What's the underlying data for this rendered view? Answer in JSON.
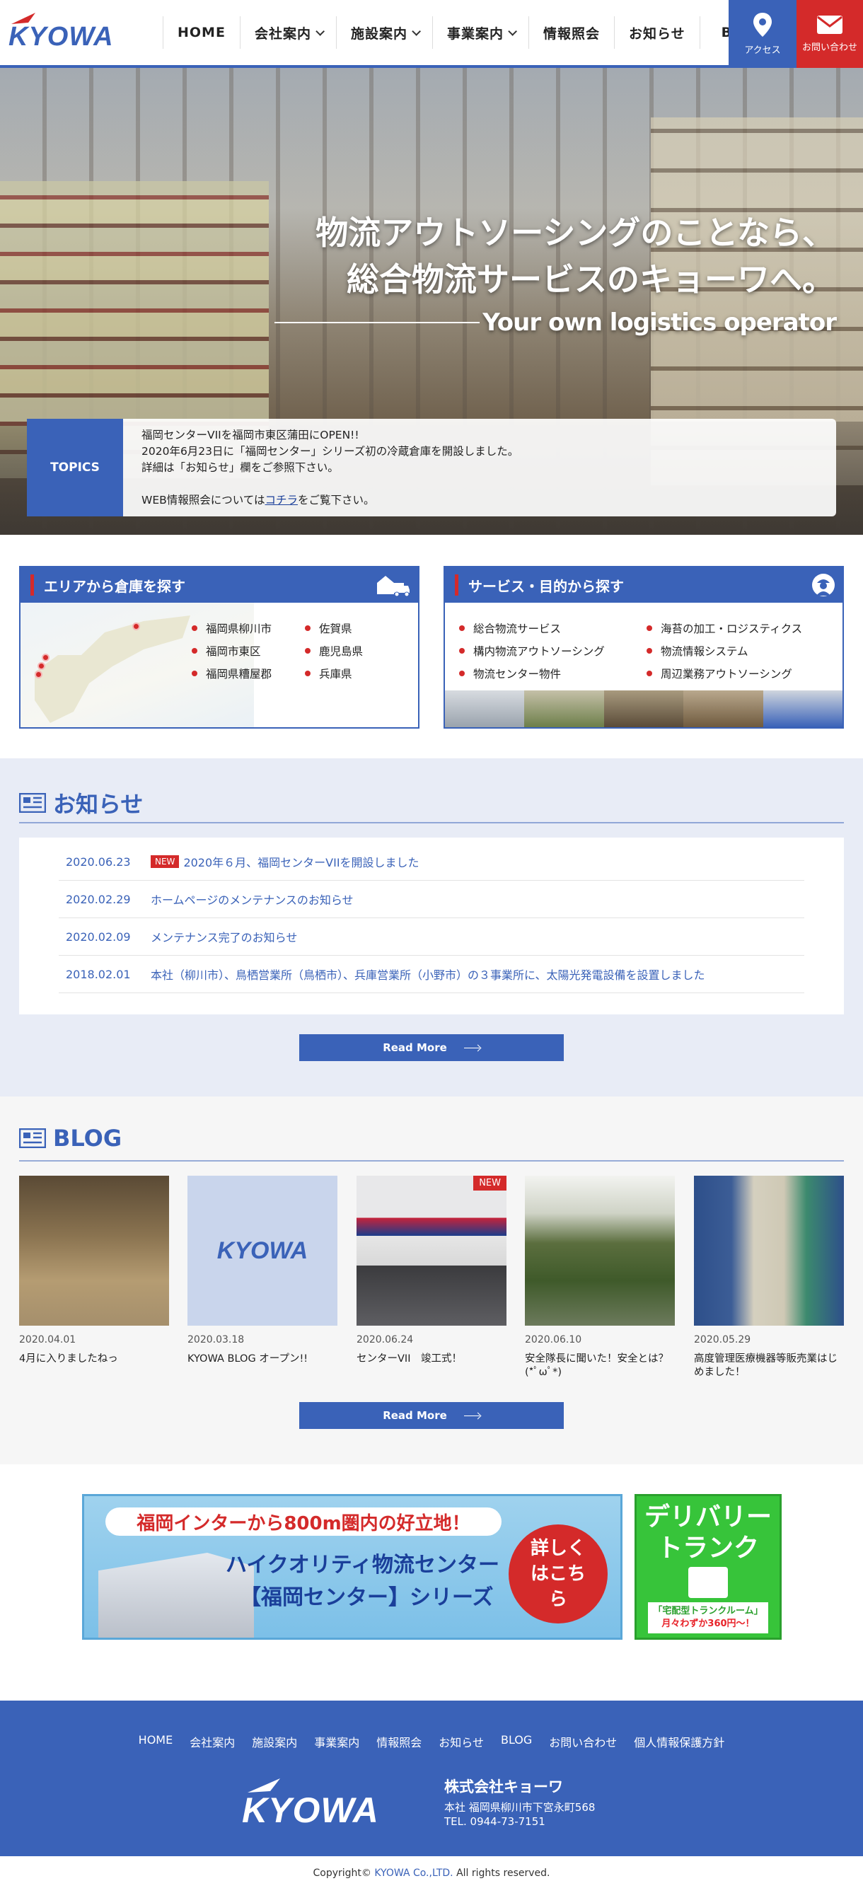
{
  "header": {
    "logo_text": "KYOWA",
    "nav": [
      {
        "label": "HOME",
        "dropdown": false
      },
      {
        "label": "会社案内",
        "dropdown": true
      },
      {
        "label": "施設案内",
        "dropdown": true
      },
      {
        "label": "事業案内",
        "dropdown": true
      },
      {
        "label": "情報照会",
        "dropdown": false
      },
      {
        "label": "お知らせ",
        "dropdown": false
      },
      {
        "label": "BLOG",
        "dropdown": false
      }
    ],
    "access_label": "アクセス",
    "contact_label": "お問い合わせ"
  },
  "hero": {
    "line1": "物流アウトソーシングのことなら、",
    "line2": "総合物流サービスのキョーワへ。",
    "tagline": "Your own logistics operator"
  },
  "topics": {
    "label": "TOPICS",
    "line1": "福岡センターVIIを福岡市東区蒲田にOPEN!!",
    "line2": "2020年6月23日に「福岡センター」シリーズ初の冷蔵倉庫を開設しました。",
    "line3": "詳細は「お知らせ」欄をご参照下さい。",
    "line4_pre": "WEB情報照会については",
    "line4_link": "コチラ",
    "line4_post": "をご覧下さい。"
  },
  "area_search": {
    "title": "エリアから倉庫を探す",
    "col1": [
      "福岡県柳川市",
      "福岡市東区",
      "福岡県糟屋郡"
    ],
    "col2": [
      "佐賀県",
      "鹿児島県",
      "兵庫県"
    ]
  },
  "service_search": {
    "title": "サービス・目的から探す",
    "col1": [
      "総合物流サービス",
      "構内物流アウトソーシング",
      "物流センター物件"
    ],
    "col2": [
      "海苔の加工・ロジスティクス",
      "物流情報システム",
      "周辺業務アウトソーシング"
    ]
  },
  "news": {
    "title": "お知らせ",
    "new_badge": "NEW",
    "items": [
      {
        "date": "2020.06.23",
        "title": "2020年６月、福岡センターVIIを開設しました",
        "is_new": true
      },
      {
        "date": "2020.02.29",
        "title": "ホームページのメンテナンスのお知らせ",
        "is_new": false
      },
      {
        "date": "2020.02.09",
        "title": "メンテナンス完了のお知らせ",
        "is_new": false
      },
      {
        "date": "2018.02.01",
        "title": "本社（柳川市）、鳥栖営業所（鳥栖市）、兵庫営業所（小野市）の３事業所に、太陽光発電設備を設置しました",
        "is_new": false
      }
    ],
    "read_more": "Read More"
  },
  "blog": {
    "title": "BLOG",
    "new_badge": "NEW",
    "posts": [
      {
        "date": "2020.04.01",
        "title": "4月に入りましたねっ"
      },
      {
        "date": "2020.03.18",
        "title": "KYOWA BLOG オープン!!"
      },
      {
        "date": "2020.06.24",
        "title": "センターVII　竣工式！"
      },
      {
        "date": "2020.06.10",
        "title": "安全隊長に聞いた！安全とは？(*ﾟωﾟ*)"
      },
      {
        "date": "2020.05.29",
        "title": "高度管理医療機器等販売業はじめました！"
      }
    ],
    "placeholder_logo": "KYOWA",
    "read_more": "Read More"
  },
  "banner_center": {
    "top": "福岡インターから800m圏内の好立地！",
    "line2": "ハイクオリティ物流センター",
    "line3": "【福岡センター】シリーズ",
    "cta": "詳しくはこちら"
  },
  "banner_trunk": {
    "title1": "デリバリー",
    "title2": "トランク",
    "sub1": "「宅配型トランクルーム」",
    "sub2": "月々わずか360円〜！"
  },
  "footer": {
    "nav": [
      "HOME",
      "会社案内",
      "施設案内",
      "事業案内",
      "情報照会",
      "お知らせ",
      "BLOG",
      "お問い合わせ",
      "個人情報保護方針"
    ],
    "company": "株式会社キョーワ",
    "address": "本社 福岡県柳川市下宮永町568",
    "tel": "TEL. 0944-73-7151",
    "copy_pre": "Copyright© ",
    "copy_brand": "KYOWA Co.,LTD.",
    "copy_post": " All rights reserved."
  },
  "colors": {
    "primary": "#3a62b8",
    "accent": "#d42a2a",
    "green": "#37c43a"
  }
}
